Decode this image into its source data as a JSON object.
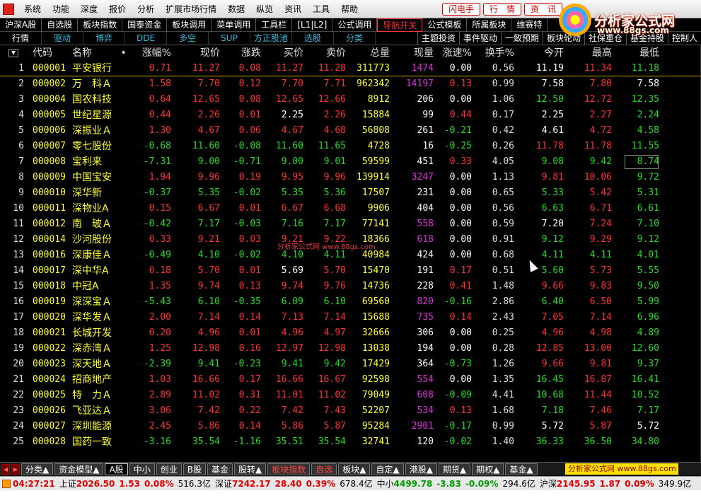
{
  "menubar": {
    "items": [
      "系统",
      "功能",
      "深度",
      "报价",
      "分析",
      "扩展市场行情",
      "数据",
      "纵览",
      "资讯",
      "工具",
      "帮助"
    ],
    "buttons": [
      "闪电手",
      "行　情",
      "资　讯"
    ]
  },
  "logo": {
    "text": "分析家公式网",
    "url": "www.88gs.com"
  },
  "category_tabs": [
    "沪深A股",
    "自选股",
    "板块指数",
    "国泰资金",
    "板块调用",
    "菜单调用",
    "工具栏",
    "[L1|L2]",
    "公式调用",
    "导航开关",
    "公式模板",
    "所属板块",
    "维赛特"
  ],
  "active_category": "导航开关",
  "sub_tabs": [
    "行情",
    "驱动",
    "博弈",
    "DDE",
    "多空",
    "SUP",
    "方正股池",
    "选股",
    "分类"
  ],
  "selected_sub_tab": "行情",
  "sub_tabs_right": [
    "主题投资",
    "事件驱动",
    "一致预期",
    "板块轮动",
    "社保重仓",
    "基金持股",
    "控制人"
  ],
  "table": {
    "headers": {
      "code": "代码",
      "name": "名称",
      "dot": "•",
      "chg_pct": "涨幅%",
      "price": "现价",
      "diff": "涨跌",
      "bid": "买价",
      "ask": "卖价",
      "volume": "总量",
      "cur_vol": "现量",
      "speed": "涨速%",
      "turnover": "换手%",
      "open": "今开",
      "high": "最高",
      "low": "最低"
    },
    "rows": [
      {
        "n": "1",
        "code": "000001",
        "name": "平安银行",
        "chg": "0.71",
        "price": "11.27",
        "diff": "0.08",
        "bid": "11.27",
        "ask": "11.28",
        "vol": "311773",
        "cur": "1474",
        "spd": "0.00",
        "turn": "0.56",
        "open": "11.19",
        "high": "11.34",
        "low": "11.18"
      },
      {
        "n": "2",
        "code": "000002",
        "name": "万　科Ａ",
        "chg": "1.58",
        "price": "7.70",
        "diff": "0.12",
        "bid": "7.70",
        "ask": "7.71",
        "vol": "962342",
        "cur": "14197",
        "spd": "0.13",
        "turn": "0.99",
        "open": "7.58",
        "high": "7.80",
        "low": "7.58"
      },
      {
        "n": "3",
        "code": "000004",
        "name": "国农科技",
        "chg": "0.64",
        "price": "12.65",
        "diff": "0.08",
        "bid": "12.65",
        "ask": "12.66",
        "vol": "8912",
        "cur": "206",
        "spd": "0.00",
        "turn": "1.06",
        "open": "12.50",
        "high": "12.72",
        "low": "12.35"
      },
      {
        "n": "4",
        "code": "000005",
        "name": "世纪星源",
        "chg": "0.44",
        "price": "2.26",
        "diff": "0.01",
        "bid": "2.25",
        "ask": "2.26",
        "vol": "15884",
        "cur": "99",
        "spd": "0.44",
        "turn": "0.17",
        "open": "2.25",
        "high": "2.27",
        "low": "2.24"
      },
      {
        "n": "5",
        "code": "000006",
        "name": "深振业Ａ",
        "chg": "1.30",
        "price": "4.67",
        "diff": "0.06",
        "bid": "4.67",
        "ask": "4.68",
        "vol": "56808",
        "cur": "261",
        "spd": "-0.21",
        "turn": "0.42",
        "open": "4.61",
        "high": "4.72",
        "low": "4.58"
      },
      {
        "n": "6",
        "code": "000007",
        "name": "零七股份",
        "chg": "-0.68",
        "price": "11.60",
        "diff": "-0.08",
        "bid": "11.60",
        "ask": "11.65",
        "vol": "4728",
        "cur": "16",
        "spd": "-0.25",
        "turn": "0.26",
        "open": "11.78",
        "high": "11.78",
        "low": "11.55"
      },
      {
        "n": "7",
        "code": "000008",
        "name": "宝利来",
        "chg": "-7.31",
        "price": "9.00",
        "diff": "-0.71",
        "bid": "9.00",
        "ask": "9.01",
        "vol": "59599",
        "cur": "451",
        "spd": "0.33",
        "turn": "4.05",
        "open": "9.08",
        "high": "9.42",
        "low": "8.74"
      },
      {
        "n": "8",
        "code": "000009",
        "name": "中国宝安",
        "chg": "1.94",
        "price": "9.96",
        "diff": "0.19",
        "bid": "9.95",
        "ask": "9.96",
        "vol": "139914",
        "cur": "3247",
        "spd": "0.00",
        "turn": "1.13",
        "open": "9.81",
        "high": "10.06",
        "low": "9.72"
      },
      {
        "n": "9",
        "code": "000010",
        "name": "深华新",
        "chg": "-0.37",
        "price": "5.35",
        "diff": "-0.02",
        "bid": "5.35",
        "ask": "5.36",
        "vol": "17507",
        "cur": "231",
        "spd": "0.00",
        "turn": "0.65",
        "open": "5.33",
        "high": "5.42",
        "low": "5.31"
      },
      {
        "n": "10",
        "code": "000011",
        "name": "深物业A",
        "chg": "0.15",
        "price": "6.67",
        "diff": "0.01",
        "bid": "6.67",
        "ask": "6.68",
        "vol": "9906",
        "cur": "404",
        "spd": "0.00",
        "turn": "0.56",
        "open": "6.63",
        "high": "6.71",
        "low": "6.61"
      },
      {
        "n": "11",
        "code": "000012",
        "name": "南　玻Ａ",
        "chg": "-0.42",
        "price": "7.17",
        "diff": "-0.03",
        "bid": "7.16",
        "ask": "7.17",
        "vol": "77141",
        "cur": "558",
        "spd": "0.00",
        "turn": "0.59",
        "open": "7.20",
        "high": "7.24",
        "low": "7.10"
      },
      {
        "n": "12",
        "code": "000014",
        "name": "沙河股份",
        "chg": "0.33",
        "price": "9.21",
        "diff": "0.03",
        "bid": "9.21",
        "ask": "9.22",
        "vol": "18366",
        "cur": "618",
        "spd": "0.00",
        "turn": "0.91",
        "open": "9.12",
        "high": "9.29",
        "low": "9.12"
      },
      {
        "n": "13",
        "code": "000016",
        "name": "深康佳Ａ",
        "chg": "-0.49",
        "price": "4.10",
        "diff": "-0.02",
        "bid": "4.10",
        "ask": "4.11",
        "vol": "40984",
        "cur": "424",
        "spd": "0.00",
        "turn": "0.68",
        "open": "4.11",
        "high": "4.11",
        "low": "4.01"
      },
      {
        "n": "14",
        "code": "000017",
        "name": "深中华A",
        "chg": "0.18",
        "price": "5.70",
        "diff": "0.01",
        "bid": "5.69",
        "ask": "5.70",
        "vol": "15470",
        "cur": "191",
        "spd": "0.17",
        "turn": "0.51",
        "open": "5.60",
        "high": "5.73",
        "low": "5.55"
      },
      {
        "n": "15",
        "code": "000018",
        "name": "中冠A",
        "chg": "1.35",
        "price": "9.74",
        "diff": "0.13",
        "bid": "9.74",
        "ask": "9.76",
        "vol": "14736",
        "cur": "228",
        "spd": "0.41",
        "turn": "1.48",
        "open": "9.66",
        "high": "9.83",
        "low": "9.50"
      },
      {
        "n": "16",
        "code": "000019",
        "name": "深深宝Ａ",
        "chg": "-5.43",
        "price": "6.10",
        "diff": "-0.35",
        "bid": "6.09",
        "ask": "6.10",
        "vol": "69560",
        "cur": "820",
        "spd": "-0.16",
        "turn": "2.86",
        "open": "6.40",
        "high": "6.50",
        "low": "5.99"
      },
      {
        "n": "17",
        "code": "000020",
        "name": "深华发Ａ",
        "chg": "2.00",
        "price": "7.14",
        "diff": "0.14",
        "bid": "7.13",
        "ask": "7.14",
        "vol": "15688",
        "cur": "735",
        "spd": "0.14",
        "turn": "2.43",
        "open": "7.05",
        "high": "7.14",
        "low": "6.96"
      },
      {
        "n": "18",
        "code": "000021",
        "name": "长城开发",
        "chg": "0.20",
        "price": "4.96",
        "diff": "0.01",
        "bid": "4.96",
        "ask": "4.97",
        "vol": "32666",
        "cur": "306",
        "spd": "0.00",
        "turn": "0.25",
        "open": "4.96",
        "high": "4.98",
        "low": "4.89"
      },
      {
        "n": "19",
        "code": "000022",
        "name": "深赤湾Ａ",
        "chg": "1.25",
        "price": "12.98",
        "diff": "0.16",
        "bid": "12.97",
        "ask": "12.98",
        "vol": "13038",
        "cur": "194",
        "spd": "0.00",
        "turn": "0.28",
        "open": "12.85",
        "high": "13.00",
        "low": "12.60"
      },
      {
        "n": "20",
        "code": "000023",
        "name": "深天地Ａ",
        "chg": "-2.39",
        "price": "9.41",
        "diff": "-0.23",
        "bid": "9.41",
        "ask": "9.42",
        "vol": "17429",
        "cur": "364",
        "spd": "-0.73",
        "turn": "1.26",
        "open": "9.66",
        "high": "9.81",
        "low": "9.37"
      },
      {
        "n": "21",
        "code": "000024",
        "name": "招商地产",
        "chg": "1.03",
        "price": "16.66",
        "diff": "0.17",
        "bid": "16.66",
        "ask": "16.67",
        "vol": "92598",
        "cur": "554",
        "spd": "0.00",
        "turn": "1.35",
        "open": "16.45",
        "high": "16.87",
        "low": "16.41"
      },
      {
        "n": "22",
        "code": "000025",
        "name": "特　力Ａ",
        "chg": "2.89",
        "price": "11.02",
        "diff": "0.31",
        "bid": "11.01",
        "ask": "11.02",
        "vol": "79049",
        "cur": "608",
        "spd": "-0.09",
        "turn": "4.41",
        "open": "10.68",
        "high": "11.44",
        "low": "10.52"
      },
      {
        "n": "23",
        "code": "000026",
        "name": "飞亚达Ａ",
        "chg": "3.06",
        "price": "7.42",
        "diff": "0.22",
        "bid": "7.42",
        "ask": "7.43",
        "vol": "52207",
        "cur": "534",
        "spd": "0.13",
        "turn": "1.68",
        "open": "7.18",
        "high": "7.46",
        "low": "7.17"
      },
      {
        "n": "24",
        "code": "000027",
        "name": "深圳能源",
        "chg": "2.45",
        "price": "5.86",
        "diff": "0.14",
        "bid": "5.86",
        "ask": "5.87",
        "vol": "95284",
        "cur": "2901",
        "spd": "-0.17",
        "turn": "0.99",
        "open": "5.72",
        "high": "5.87",
        "low": "5.72"
      },
      {
        "n": "25",
        "code": "000028",
        "name": "国药一致",
        "chg": "-3.16",
        "price": "35.54",
        "diff": "-1.16",
        "bid": "35.51",
        "ask": "35.54",
        "vol": "32741",
        "cur": "120",
        "spd": "-0.02",
        "turn": "1.40",
        "open": "36.33",
        "high": "36.50",
        "low": "34.80"
      }
    ]
  },
  "watermark": "分析家公式网 www.88gs.com",
  "bottom_tabs": [
    "分类▲",
    "资金模型▲",
    "A股",
    "中小",
    "创业",
    "B股",
    "基金",
    "股转▲",
    "板块指数",
    "自选",
    "板块▲",
    "自定▲",
    "港股▲",
    "期货▲",
    "期权▲",
    "基金▲"
  ],
  "active_bottom_tab": "A股",
  "bottom_ad": "分析家公式网 www.88gs.com",
  "status": {
    "time": "04:27:21",
    "sh_label": "上证",
    "sh_value": "2026.50",
    "sh_chg": "1.53",
    "sh_pct": "0.08%",
    "sh_amt": "516.3亿",
    "sz_label": "深证",
    "sz_value": "7242.17",
    "sz_chg": "28.40",
    "sz_pct": "0.39%",
    "sz_amt": "678.4亿",
    "zx_label": "中小",
    "zx_value": "4499.78",
    "zx_chg": "-3.83",
    "zx_pct": "-0.09%",
    "zx_amt": "294.6亿",
    "hs_label": "沪深",
    "hs_value": "2145.95",
    "hs_chg": "1.87",
    "hs_pct": "0.09%",
    "hs_amt": "349.9亿"
  },
  "colors": {
    "up": "#ff3333",
    "down": "#22dd22",
    "flat": "#ffffff",
    "code": "#ffff33",
    "highlight": "#dd33dd",
    "subtab": "#33bbdd"
  }
}
